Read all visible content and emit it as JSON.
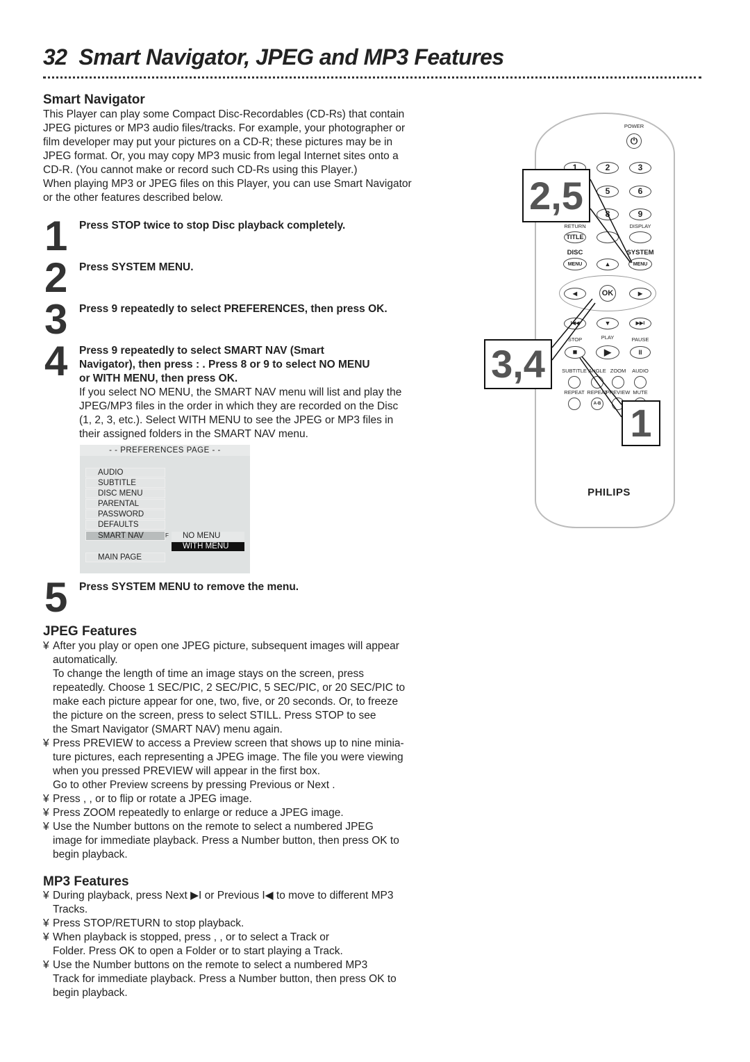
{
  "page": {
    "number": "32",
    "title": "Smart Navigator, JPEG and MP3 Features"
  },
  "smart_nav": {
    "heading": "Smart Navigator",
    "intro": [
      "This Player can play some Compact Disc-Recordables (CD-Rs) that contain",
      "JPEG pictures or MP3 audio files/tracks. For example, your photographer or",
      "film developer may put your pictures on a CD-R; these pictures may be in",
      "JPEG format. Or, you may copy MP3 music from legal Internet sites onto a",
      "CD-R. (You cannot make or record such CD-Rs using this Player.)",
      "When playing MP3 or JPEG files on this Player, you can use Smart Navigator",
      "or the other features described below."
    ],
    "steps": [
      {
        "num": "1",
        "text": [
          "Press STOP    twice to stop Disc playback completely."
        ]
      },
      {
        "num": "2",
        "text": [
          "Press SYSTEM MENU."
        ]
      },
      {
        "num": "3",
        "text": [
          "Press 9  repeatedly to select PREFERENCES, then press OK."
        ]
      },
      {
        "num": "4",
        "text": [
          "Press 9  repeatedly to select SMART NAV (Smart",
          "Navigator), then press :  . Press 8  or 9  to select NO MENU",
          "or WITH MENU, then press OK."
        ],
        "note": [
          "If you select NO MENU, the SMART NAV menu will list and play the",
          "JPEG/MP3 files in the order in which they are recorded on the Disc",
          "(1, 2, 3, etc.). Select WITH MENU to see the JPEG or MP3 files in",
          "their assigned folders in the SMART NAV menu."
        ]
      },
      {
        "num": "5",
        "text": [
          "Press SYSTEM MENU to remove the menu."
        ]
      }
    ]
  },
  "menu": {
    "header": "- -  PREFERENCES PAGE  - -",
    "items": [
      "AUDIO",
      "SUBTITLE",
      "DISC MENU",
      "PARENTAL",
      "PASSWORD",
      "DEFAULTS",
      "SMART NAV",
      "MAIN PAGE"
    ],
    "arrow": "F",
    "options": [
      "NO MENU",
      "WITH MENU"
    ]
  },
  "jpeg": {
    "heading": "JPEG Features",
    "bullets": [
      [
        "After you play or open one JPEG picture, subsequent images will appear",
        "automatically.",
        "To change the length of time an image stays on the screen, press",
        "repeatedly. Choose 1 SEC/PIC, 2 SEC/PIC, 5 SEC/PIC, or 20 SEC/PIC to",
        "make each picture appear for one, two, five, or 20 seconds. Or, to freeze",
        "the picture on the screen, press      to select STILL. Press STOP      to see",
        "the Smart Navigator (SMART NAV) menu again."
      ],
      [
        "Press PREVIEW to access a Preview screen that shows up to nine minia-",
        "ture pictures, each representing a JPEG image. The file you were viewing",
        "when you pressed PREVIEW will appear in the first box.",
        "Go to other Preview screens by pressing Previous          or Next         ."
      ],
      [
        "Press     ,     , or      to flip or rotate a JPEG image."
      ],
      [
        "Press ZOOM repeatedly to enlarge or reduce a JPEG image."
      ],
      [
        "Use the Number buttons on the remote to select a numbered JPEG",
        "image for immediate playback. Press a Number button, then press OK to",
        "begin playback."
      ]
    ]
  },
  "mp3": {
    "heading": "MP3 Features",
    "bullets": [
      [
        "During playback, press Next ▶I or Previous I◀ to move to different MP3",
        "Tracks."
      ],
      [
        "Press STOP/RETURN      to stop playback."
      ],
      [
        "When playback is stopped, press     ,     ,      or      to select a Track or",
        "Folder. Press OK to open a Folder or to start playing a Track."
      ],
      [
        "Use the Number buttons on the remote to select a numbered MP3",
        "Track for immediate playback. Press a Number button, then press OK to",
        "begin playback."
      ]
    ]
  },
  "bullet_char": "¥",
  "remote": {
    "brand": "PHILIPS",
    "power": "POWER",
    "numbers": [
      "1",
      "2",
      "3",
      "5",
      "6",
      "8",
      "9"
    ],
    "return": "RETURN",
    "title": "TITLE",
    "display": "DISPLAY",
    "disc": "DISC",
    "system": "SYSTEM",
    "menu": "MENU",
    "ok": "OK",
    "stop": "STOP",
    "play": "PLAY",
    "pause": "PAUSE",
    "subtitle": "SUBTITLE",
    "angle": "ANGLE",
    "zoom": "ZOOM",
    "audio": "AUDIO",
    "repeat": "REPEAT",
    "repeat_ab": "REPEAT",
    "ab": "A-B",
    "preview": "PREVIEW",
    "mute": "MUTE",
    "callouts": [
      "2,5",
      "3,4",
      "1"
    ]
  }
}
